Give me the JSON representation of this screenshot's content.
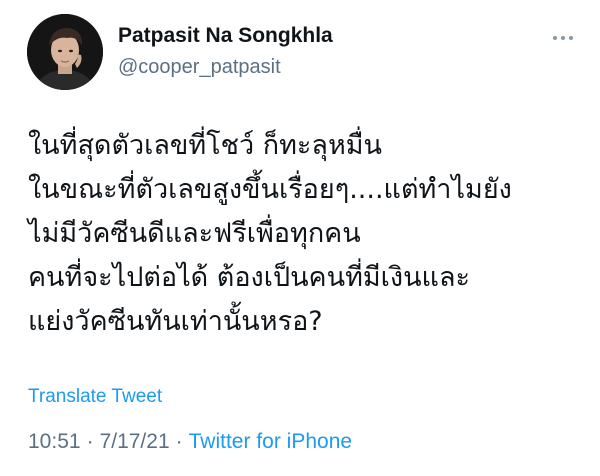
{
  "user": {
    "display_name": "Patpasit Na Songkhla",
    "handle": "@cooper_patpasit",
    "avatar_icon": "profile-photo"
  },
  "more_icon": "more-horizontal-icon",
  "tweet": {
    "lines": [
      "ในที่สุดตัวเลขที่โชว์ ก็ทะลุหมื่น",
      "ในขณะที่ตัวเลขสูงขึ้นเรื่อยๆ....แต่ทำไมยัง",
      "ไม่มีวัคซีนดีและฟรีเพื่อทุกคน",
      "คนที่จะไปต่อได้ ต้องเป็นคนที่มีเงินและ",
      "แย่งวัคซีนทันเท่านั้นหรอ?"
    ],
    "translate_label": "Translate Tweet",
    "time": "10:51",
    "date": "7/17/21",
    "separator": "·",
    "source": "Twitter for iPhone"
  },
  "colors": {
    "link": "#1d9bf0",
    "secondary_text": "#5b7083",
    "primary_text": "#0f1419"
  }
}
